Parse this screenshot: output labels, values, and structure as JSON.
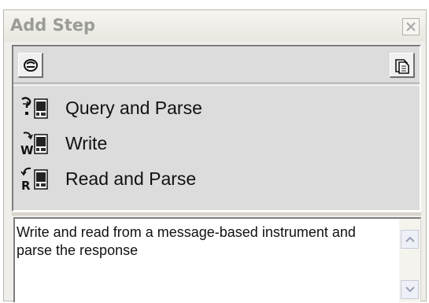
{
  "panel": {
    "title": "Add Step",
    "close_icon": "close-x-icon"
  },
  "toolbar": {
    "left_icon": "instrument-io-icon",
    "right_icon": "folder-pages-icon"
  },
  "steps": [
    {
      "label": "Query and Parse",
      "icon": "query-parse-icon"
    },
    {
      "label": "Write",
      "icon": "write-icon"
    },
    {
      "label": "Read and Parse",
      "icon": "read-parse-icon"
    }
  ],
  "description": {
    "text": "Write and read from a message-based instrument and parse the response"
  },
  "colors": {
    "panel_bg": "#efeeea",
    "list_bg": "#dcdcdc",
    "title_text": "#9b9b98"
  }
}
